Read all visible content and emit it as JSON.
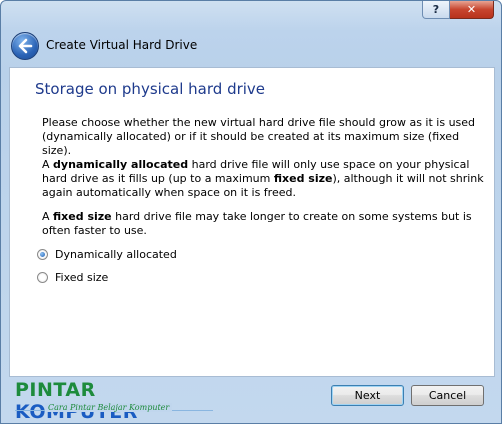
{
  "window": {
    "title": "Create Virtual Hard Drive",
    "help_label": "?",
    "close_label": "✕"
  },
  "page": {
    "heading": "Storage on physical hard drive",
    "intro": "Please choose whether the new virtual hard drive file should grow as it is used (dynamically allocated) or if it should be created at its maximum size (fixed size).",
    "dynamic_para": {
      "pre": "A ",
      "bold1": "dynamically allocated",
      "mid": " hard drive file will only use space on your physical hard drive as it fills up (up to a maximum ",
      "bold2": "fixed size",
      "post": "), although it will not shrink again automatically when space on it is freed."
    },
    "fixed_para": {
      "pre": "A ",
      "bold": "fixed size",
      "post": " hard drive file may take longer to create on some systems but is often faster to use."
    },
    "options": [
      {
        "label": "Dynamically allocated",
        "checked": true
      },
      {
        "label": "Fixed size",
        "checked": false
      }
    ]
  },
  "footer": {
    "logo_word1": "PINTAR",
    "logo_word2": "KOMPUTER",
    "logo_tagline": "Cara Pintar Belajar Komputer",
    "next_label": "Next",
    "cancel_label": "Cancel"
  },
  "icons": {
    "back": "back-arrow-icon",
    "help": "help-icon",
    "close": "close-icon"
  },
  "colors": {
    "heading": "#1e3a8c",
    "logo_green": "#1d8b3c",
    "logo_blue": "#1a5cc2"
  }
}
